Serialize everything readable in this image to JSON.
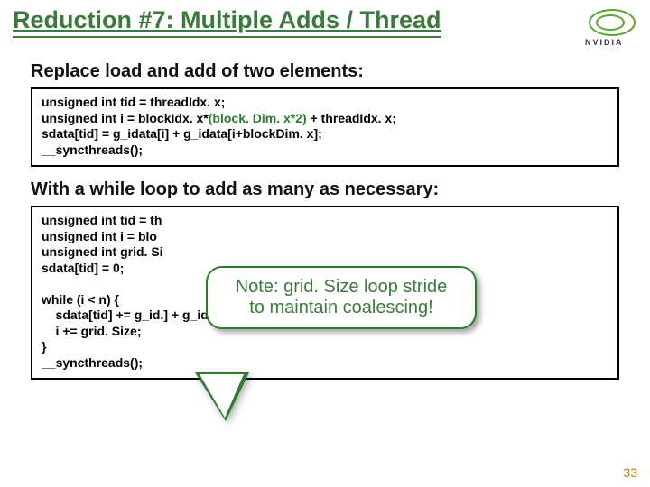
{
  "brand": "NVIDIA",
  "title": "Reduction #7: Multiple Adds / Thread",
  "subhead1": "Replace load and add of two elements:",
  "codebox1": {
    "l1a": "unsigned int tid = threadIdx. x;",
    "l2a": "unsigned int i = blockIdx. x*",
    "l2b": "(block. Dim. x*2)",
    "l2c": " + threadIdx. x;",
    "l3a": "sdata[tid] = g_idata[i] + g_idata[i+blockDim. x];",
    "l4a": "__syncthreads();"
  },
  "subhead2": "With a while loop to add as many as necessary:",
  "codebox2": {
    "l1": "unsigned int tid = th",
    "l2": "unsigned int i = blo",
    "l3": "unsigned int grid. Si",
    "l4": "sdata[tid] = 0;",
    "l5": "",
    "l6a": "while (i < n) {",
    "l7a": "    sdata[tid] += g_id",
    "l7b": ".] + g_idata[i+block. Size];",
    "l8": "    i += grid. Size;",
    "l9": "}",
    "l10": "__syncthreads();"
  },
  "callout": {
    "line1": "Note: grid. Size loop stride",
    "line2": "to maintain coalescing!"
  },
  "page_number": "33"
}
